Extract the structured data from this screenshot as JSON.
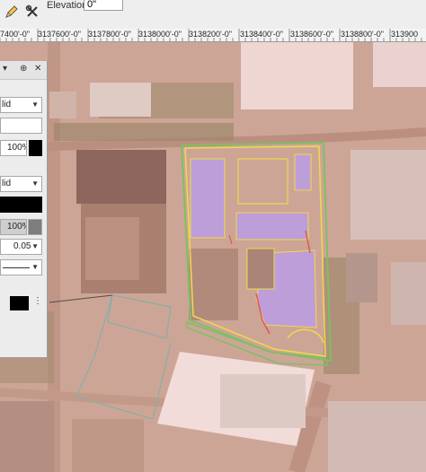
{
  "toolbar": {
    "elevation_label": "Elevation:",
    "elevation_value": "0\""
  },
  "ruler": {
    "labels": [
      "7400'-0\"",
      "3137600'-0\"",
      "3137800'-0\"",
      "3138000'-0\"",
      "3138200'-0\"",
      "3138400'-0\"",
      "3138600'-0\"",
      "3138800'-0\"",
      "313900"
    ]
  },
  "panel": {
    "fill_style": "lid",
    "opacity_1": "100%",
    "pen_style": "lid",
    "opacity_2": "100%",
    "line_weight": "0.05"
  },
  "colors": {
    "building_fill": "#b49ae6",
    "outline_yellow": "#f2e23a",
    "outline_green": "#67c25a",
    "outline_red": "#e0453a",
    "boundary_teal": "#6fb0a8",
    "map_tint": "#d9a99a"
  }
}
